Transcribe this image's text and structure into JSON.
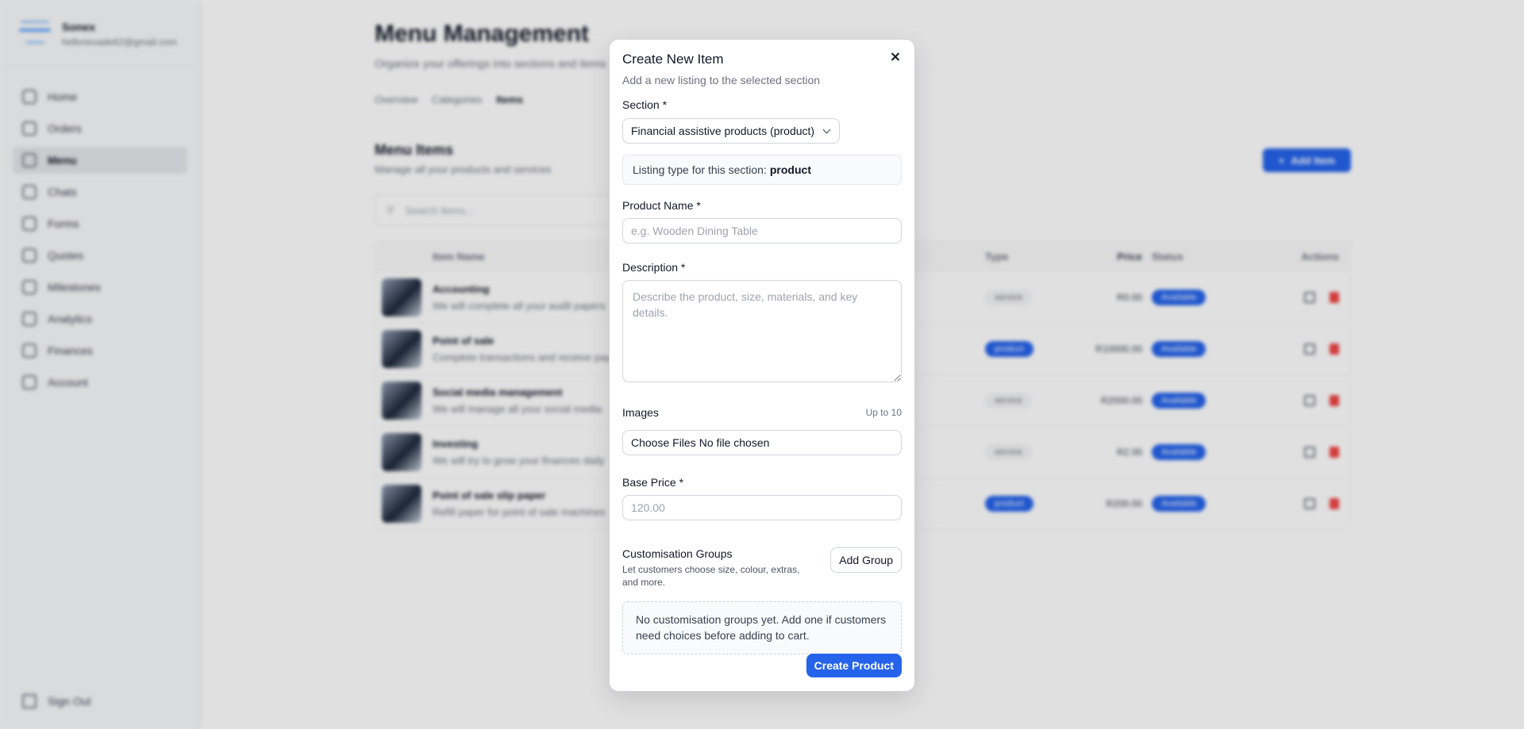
{
  "sidebar": {
    "profile_name": "Sonex",
    "profile_email": "hellonexade62@gmail.com",
    "items": [
      {
        "label": "Home"
      },
      {
        "label": "Orders"
      },
      {
        "label": "Menu"
      },
      {
        "label": "Chats"
      },
      {
        "label": "Forms"
      },
      {
        "label": "Quotes"
      },
      {
        "label": "Milestones"
      },
      {
        "label": "Analytics"
      },
      {
        "label": "Finances"
      },
      {
        "label": "Account"
      }
    ],
    "active_index": 2,
    "signout": "Sign Out"
  },
  "main": {
    "title": "Menu Management",
    "subtitle": "Organize your offerings into sections and items",
    "tabs": [
      "Overview",
      "Categories",
      "Items"
    ],
    "active_tab": "Items",
    "section_title": "Menu Items",
    "section_subtitle": "Manage all your products and services",
    "add_item": "Add Item",
    "search_placeholder": "Search items...",
    "columns": {
      "name": "Item Name",
      "type": "Type",
      "price": "Price",
      "status": "Status",
      "actions": "Actions"
    },
    "rows": [
      {
        "name": "Accounting",
        "desc": "We will complete all your audit papers",
        "type": "service",
        "price": "R0.00",
        "status": "Available"
      },
      {
        "name": "Point of sale",
        "desc": "Complete transactions and receive payments",
        "type": "product",
        "price": "R10000.00",
        "status": "Available"
      },
      {
        "name": "Social media management",
        "desc": "We will manage all your social media",
        "type": "service",
        "price": "R2000.00",
        "status": "Available"
      },
      {
        "name": "Investing",
        "desc": "We will try to grow your finances daily",
        "type": "service",
        "price": "R2.00",
        "status": "Available"
      },
      {
        "name": "Point of sale slip paper",
        "desc": "Refill paper for point of sale machines",
        "type": "product",
        "price": "R200.00",
        "status": "Available"
      }
    ]
  },
  "modal": {
    "title": "Create New Item",
    "subtitle": "Add a new listing to the selected section",
    "section_label": "Section *",
    "section_value": "Financial assistive products (product)",
    "listing_type_text": "Listing type for this section:",
    "listing_type_value": "product",
    "name_label": "Product Name *",
    "name_placeholder": "e.g. Wooden Dining Table",
    "desc_label": "Description *",
    "desc_placeholder": "Describe the product, size, materials, and key details.",
    "images_label": "Images",
    "images_hint": "Up to 10",
    "file_button": "Choose Files",
    "file_status": "No file chosen",
    "price_label": "Base Price *",
    "price_placeholder": "120.00",
    "custom_title": "Customisation Groups",
    "custom_desc": "Let customers choose size, colour, extras, and more.",
    "add_group": "Add Group",
    "empty_text": "No customisation groups yet. Add one if customers need choices before adding to cart.",
    "submit": "Create Product"
  }
}
